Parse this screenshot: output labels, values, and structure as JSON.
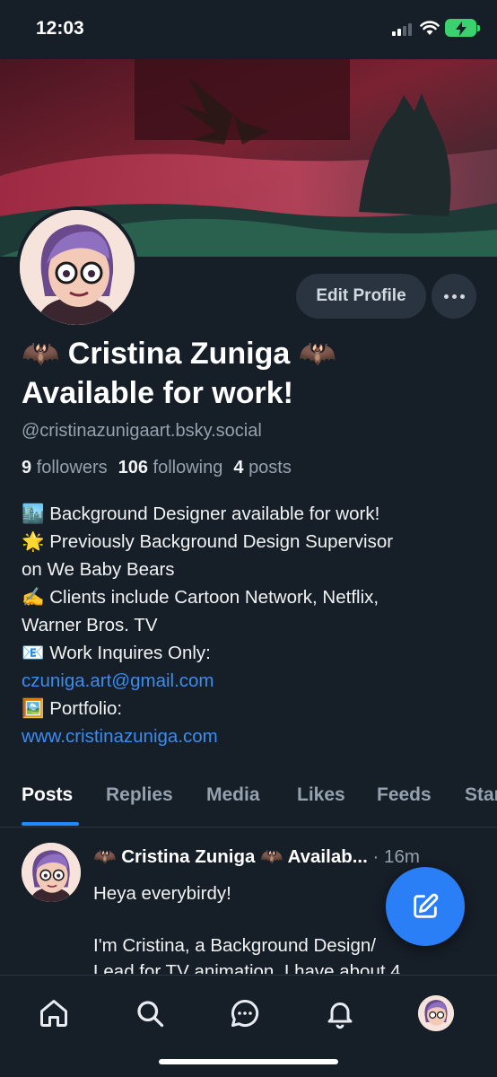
{
  "status_bar": {
    "time": "12:03"
  },
  "profile": {
    "display_name": "🦇 Cristina Zuniga 🦇\nAvailable for work!",
    "handle": "@cristinazunigaart.bsky.social",
    "edit_button": "Edit Profile",
    "stats": {
      "followers_count": "9",
      "followers_label": "followers",
      "following_count": "106",
      "following_label": "following",
      "posts_count": "4",
      "posts_label": "posts"
    },
    "bio": {
      "line1": "🏙️ Background Designer available for work!",
      "line2": "🌟 Previously Background Design Supervisor",
      "line3": "on We Baby Bears",
      "line4": "✍️ Clients include Cartoon Network, Netflix,",
      "line5": "Warner Bros. TV",
      "line6": "📧 Work Inquires Only:",
      "email": "czuniga.art@gmail.com",
      "line8": "🖼️ Portfolio:",
      "website": "www.cristinazuniga.com"
    }
  },
  "tabs": [
    "Posts",
    "Replies",
    "Media",
    "Likes",
    "Feeds",
    "Starter Packs"
  ],
  "active_tab": "Posts",
  "post": {
    "author": "🦇 Cristina Zuniga 🦇 Availab...",
    "time": " · 16m",
    "para1": "Heya everybirdy!",
    "para2": "I'm Cristina, a Background Design/",
    "para3": "Lead for TV animation. I have about 4"
  },
  "colors": {
    "accent": "#1f8bfe",
    "link": "#3c8cf0",
    "background": "#161e27",
    "fab": "#2a7ff6"
  },
  "icons": [
    "home-icon",
    "search-icon",
    "chat-icon",
    "bell-icon",
    "compose-icon",
    "wifi-icon",
    "battery-icon"
  ]
}
